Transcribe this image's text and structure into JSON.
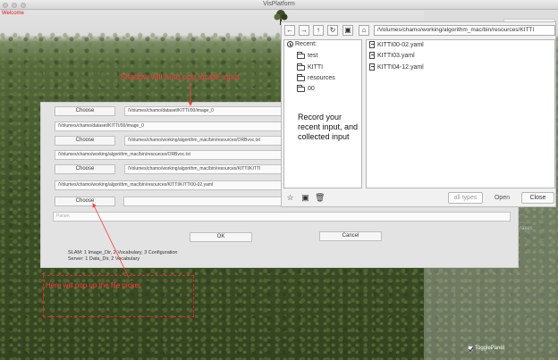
{
  "window": {
    "title": "VisPlatform"
  },
  "scene": {
    "welcome": "Welcome"
  },
  "dialog": {
    "rows": [
      {
        "button": "Choose",
        "value": "/Volumes/chamo/dataset/KITTI/00/image_0"
      },
      {
        "value": "/Volumes/chamo/dataset/KITTI/00/image_0"
      },
      {
        "button": "Choose",
        "value": "/Volumes/chamo/working/algorithm_mac/bin/resources/ORBvoc.txt"
      },
      {
        "value": "/Volumes/chamo/working/algorithm_mac/bin/resources/ORBvoc.txt"
      },
      {
        "button": "Choose",
        "value": "/Volumes/chamo/working/algorithm_mac/bin/resources/KITTI/KITTI"
      },
      {
        "value": "/Volumes/chamo/working/algorithm_mac/bin/resources/KITTI/KITTI00-02.yaml"
      },
      {
        "button": "Choose",
        "value": ""
      }
    ],
    "param_placeholder": "Param",
    "ok_label": "OK",
    "cancel_label": "Cancel",
    "info_lines": [
      "SLAM: 1 Image_Dir, 2 Vocabulary, 3 Configuration",
      "Server: 1 Data_Dir, 2 Vocabulary"
    ]
  },
  "annotations": {
    "top": "Shadow will auto pop locate input",
    "box": "Here will pop up the file picker"
  },
  "chooser": {
    "nav_icons": [
      "back-arrow-icon",
      "forward-arrow-icon",
      "up-arrow-icon",
      "refresh-icon",
      "drive-icon",
      "home-icon"
    ],
    "nav_glyphs": [
      "←",
      "→",
      "↑",
      "↻",
      "▣",
      "⌂"
    ],
    "path": "/Volumes/chamo/working/algorithm_mac/bin/resources/KITTI",
    "recent_label": "Recent:",
    "recent_items": [
      "test",
      "KITTI",
      "resources",
      "00"
    ],
    "files": [
      "KITTI00-02.yaml",
      "KITTI03.yaml",
      "KITTI04-12.yaml"
    ],
    "note": "Record your recent input, and collected input",
    "filter_placeholder": "all types",
    "open_label": "Open",
    "close_label": "Close"
  },
  "right_panel": {
    "text_lines": [
      "...",
      "...",
      "...",
      "rakes"
    ],
    "toggle_label": "TogglePanel",
    "toggle_checked": true
  },
  "colors": {
    "annotation": "#ff3a3a",
    "welcome": "#e21818"
  }
}
